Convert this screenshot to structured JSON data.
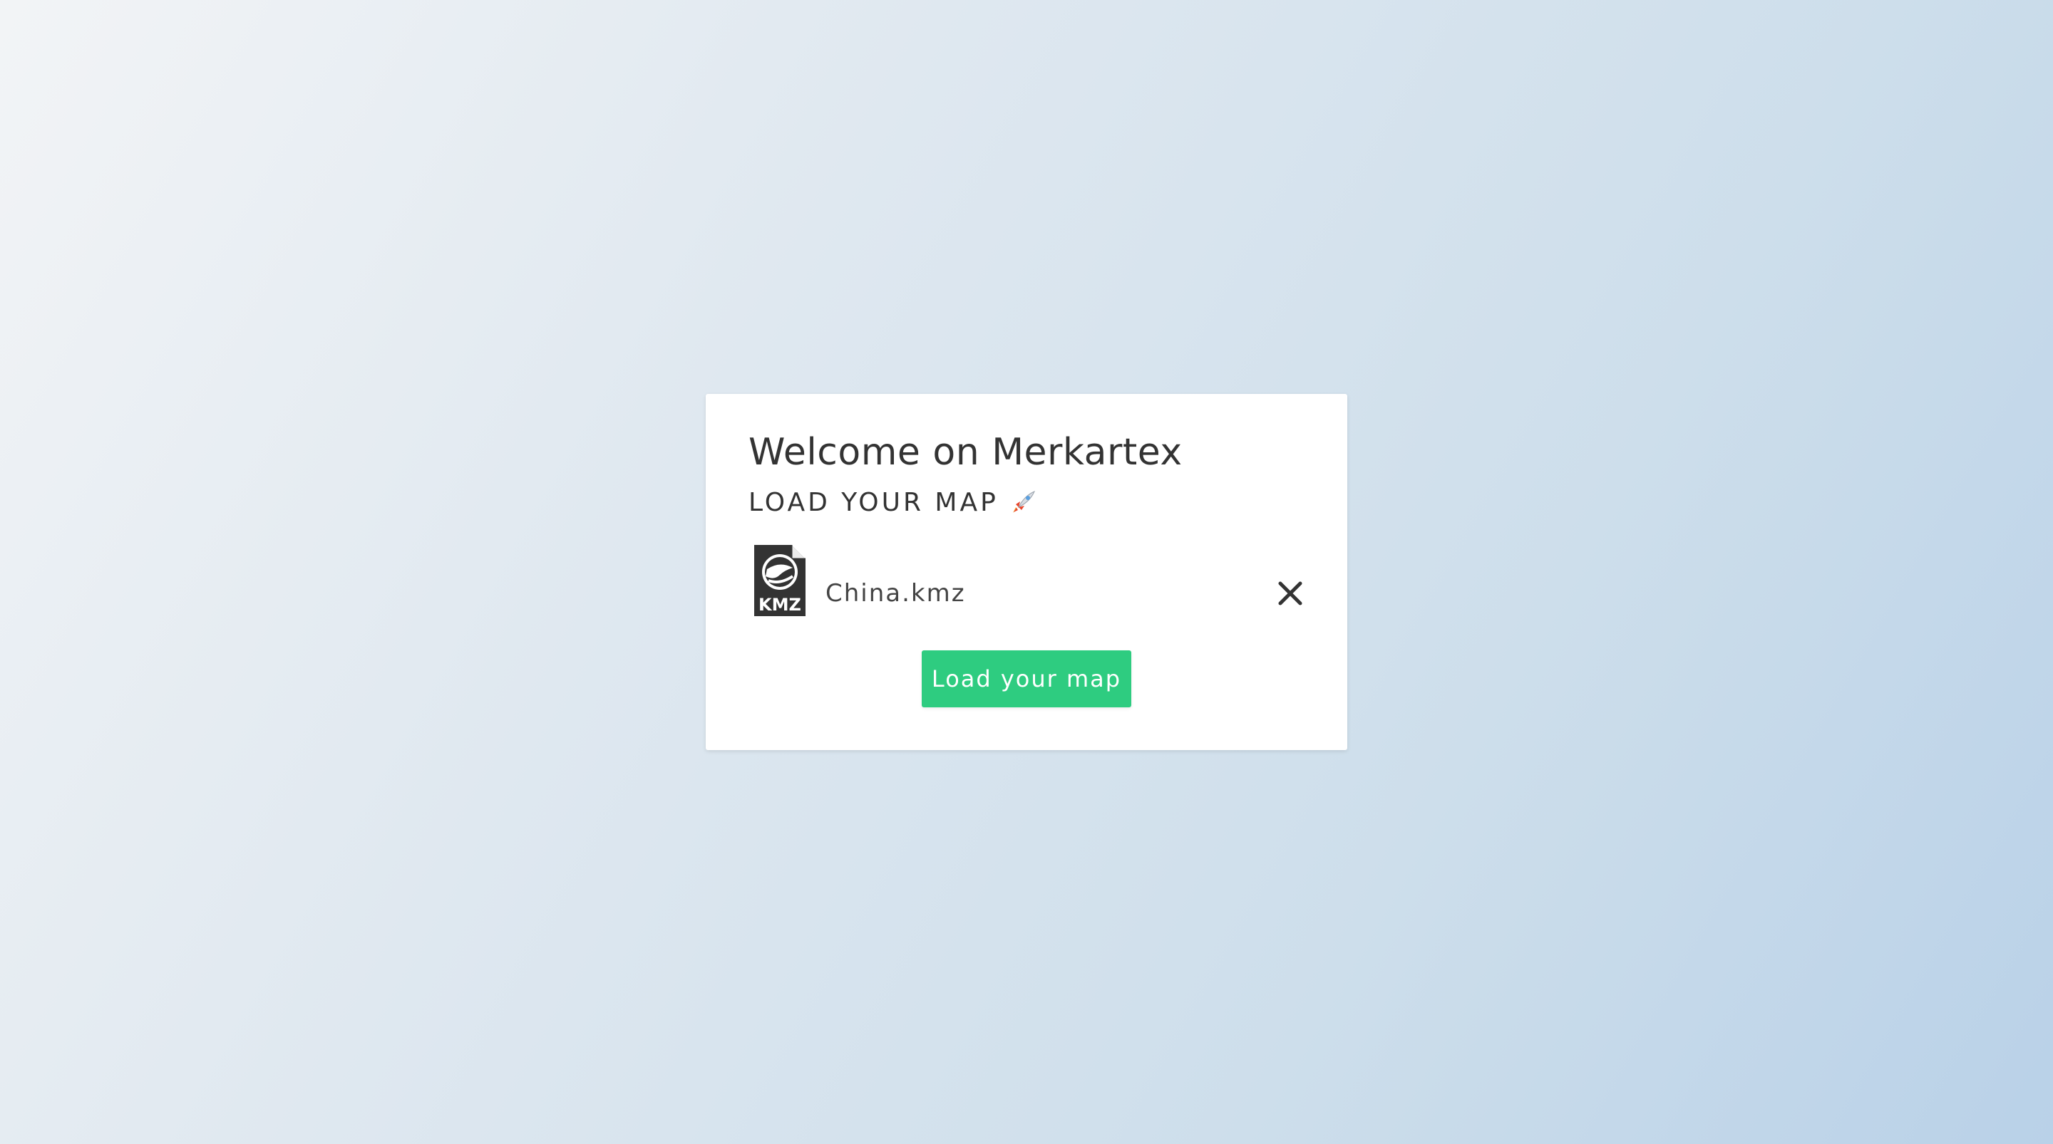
{
  "welcome": {
    "title": "Welcome on Merkartex",
    "subtitle": "LOAD YOUR MAP",
    "subtitle_icon": "rocket-icon"
  },
  "file": {
    "name": "China.kmz",
    "icon": "kmz-file-icon",
    "icon_label": "KMZ",
    "remove_icon": "close-icon"
  },
  "actions": {
    "load_label": "Load your map",
    "load_color": "#2ecc80"
  },
  "colors": {
    "background_start": "#f2f4f6",
    "background_end": "#b9d1e8",
    "card": "#ffffff",
    "text": "#333333"
  }
}
